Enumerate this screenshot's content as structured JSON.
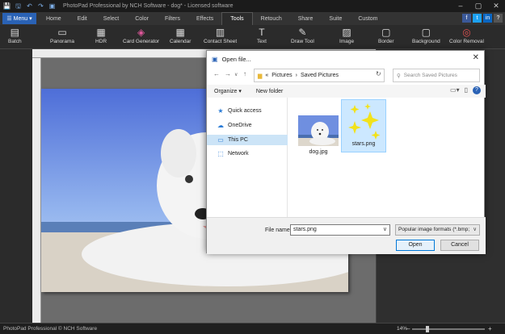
{
  "titlebar": {
    "title": "PhotoPad Professional by NCH Software - dog* - Licensed software",
    "quick_icons": [
      "💾",
      "🖫",
      "↶",
      "↷",
      "▣"
    ]
  },
  "menu": {
    "menu_label": "Menu",
    "tabs": [
      "Home",
      "Edit",
      "Select",
      "Color",
      "Filters",
      "Effects",
      "Tools",
      "Retouch",
      "Share",
      "Suite",
      "Custom"
    ],
    "active_tab": "Tools"
  },
  "tools": [
    {
      "label": "Batch",
      "icon": "▤"
    },
    {
      "label": "Panorama",
      "icon": "▭"
    },
    {
      "label": "HDR",
      "icon": "▦"
    },
    {
      "label": "Card Generator",
      "icon": "◈"
    },
    {
      "label": "Calendar",
      "icon": "▦"
    },
    {
      "label": "Contact Sheet",
      "icon": "▥"
    },
    {
      "label": "Text",
      "icon": "T"
    },
    {
      "label": "Draw Tool",
      "icon": "✎"
    },
    {
      "label": "Image",
      "icon": "▨"
    },
    {
      "label": "Border",
      "icon": "▢"
    },
    {
      "label": "Background",
      "icon": "▢"
    },
    {
      "label": "Color Removal",
      "icon": "◎"
    }
  ],
  "status": {
    "text": "PhotoPad Professional © NCH Software",
    "zoom": "14%"
  },
  "dialog": {
    "title": "Open file...",
    "path": [
      "«",
      "Pictures",
      "›",
      "Saved Pictures"
    ],
    "search_placeholder": "Search Saved Pictures",
    "organize": "Organize ▾",
    "new_folder": "New folder",
    "nav": [
      "Quick access",
      "OneDrive",
      "This PC",
      "Network"
    ],
    "files": [
      {
        "name": "dog.jpg"
      },
      {
        "name": "stars.png"
      }
    ],
    "file_name_label": "File name:",
    "file_name_value": "stars.png",
    "file_type": "Popular image formats (*.bmp;",
    "open": "Open",
    "cancel": "Cancel"
  },
  "colors": {
    "accent": "#2a62b5",
    "selection": "#cce8ff",
    "star": "#f2e21a"
  }
}
